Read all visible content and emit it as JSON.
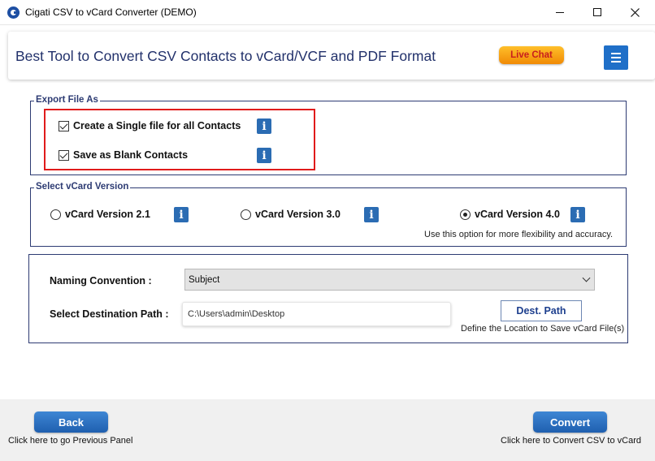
{
  "window": {
    "title": "Cigati CSV to vCard Converter (DEMO)"
  },
  "header": {
    "title": "Best Tool to Convert CSV Contacts to vCard/VCF and PDF Format",
    "live_chat": "Live Chat"
  },
  "export": {
    "legend": "Export File As",
    "options": [
      {
        "label": "Create a Single file for all Contacts",
        "checked": true
      },
      {
        "label": "Save as Blank Contacts",
        "checked": true
      }
    ]
  },
  "version": {
    "legend": "Select vCard Version",
    "options": [
      {
        "label": "vCard Version 2.1",
        "selected": false
      },
      {
        "label": "vCard Version 3.0",
        "selected": false
      },
      {
        "label": "vCard Version 4.0",
        "selected": true
      }
    ],
    "hint": "Use this option for more flexibility and accuracy."
  },
  "naming": {
    "label": "Naming Convention :",
    "selected": "Subject"
  },
  "destination": {
    "label": "Select Destination Path :",
    "value": "C:\\Users\\admin\\Desktop",
    "button": "Dest. Path",
    "hint": "Define the Location to Save vCard File(s)"
  },
  "footer": {
    "back": "Back",
    "back_hint": "Click here to go Previous Panel",
    "convert": "Convert",
    "convert_hint": "Click here to Convert CSV to vCard"
  },
  "colors": {
    "accent": "#1f6fc8",
    "title_text": "#22316b",
    "highlight_box": "#e01b1b",
    "live_chat": "#f08a05"
  }
}
